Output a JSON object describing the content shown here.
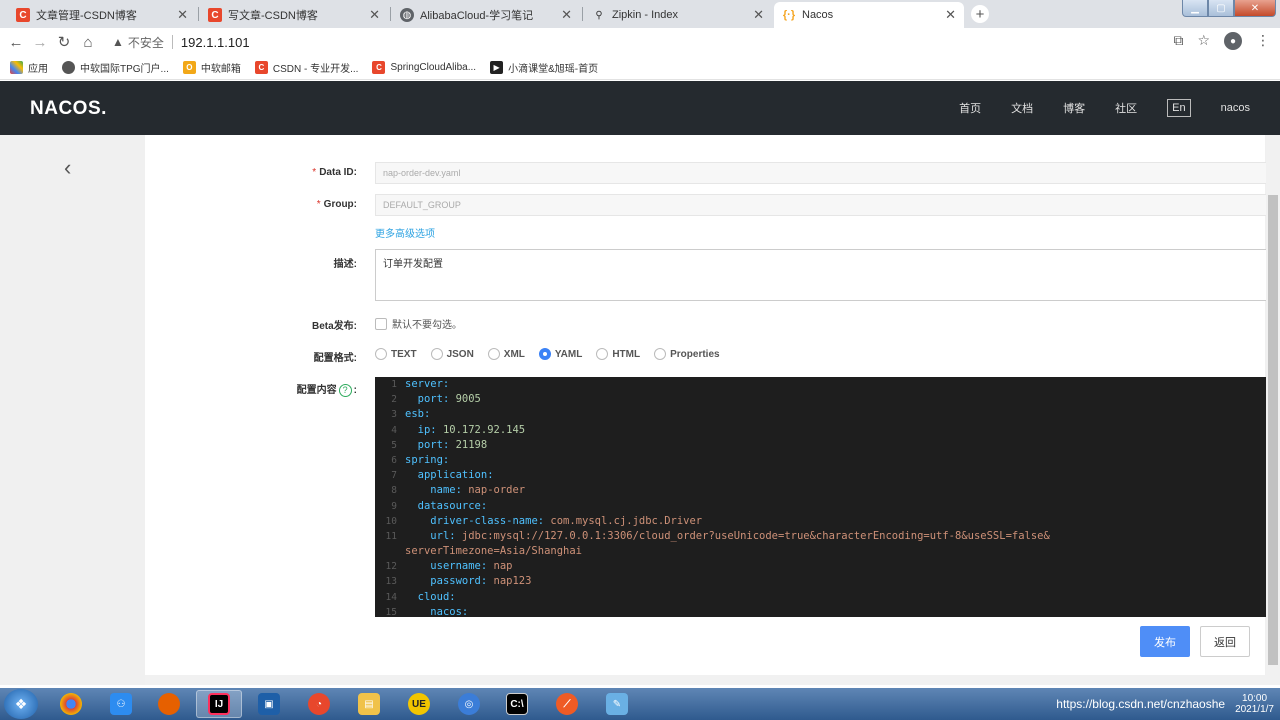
{
  "browser": {
    "tabs": [
      {
        "title": "文章管理-CSDN博客",
        "icon": "csdn-icon"
      },
      {
        "title": "写文章-CSDN博客",
        "icon": "csdn-icon"
      },
      {
        "title": "AlibabaCloud-学习笔记",
        "icon": "globe-icon"
      },
      {
        "title": "Zipkin - Index",
        "icon": "zipkin-icon"
      },
      {
        "title": "Nacos",
        "icon": "nacos-icon"
      }
    ],
    "security": "不安全",
    "url": "192.1.1.101",
    "bookmarks": [
      "应用",
      "中软国际TPG门户...",
      "中软邮箱",
      "CSDN - 专业开发...",
      "SpringCloudAliba...",
      "小滴课堂&旭瑶-首页"
    ]
  },
  "header": {
    "logo": "NACOS.",
    "menu": [
      "首页",
      "文档",
      "博客",
      "社区"
    ],
    "lang": "En",
    "user": "nacos"
  },
  "form": {
    "dataid_label": "Data ID:",
    "dataid_value": "nap-order-dev.yaml",
    "group_label": "Group:",
    "group_value": "DEFAULT_GROUP",
    "advanced": "更多高级选项",
    "desc_label": "描述:",
    "desc_value": "订单开发配置",
    "beta_label": "Beta发布:",
    "beta_hint": "默认不要勾选。",
    "format_label": "配置格式:",
    "formats": [
      "TEXT",
      "JSON",
      "XML",
      "YAML",
      "HTML",
      "Properties"
    ],
    "selected_format": "YAML",
    "content_label": "配置内容",
    "publish": "发布",
    "back": "返回"
  },
  "editor": {
    "lines": [
      {
        "n": "1",
        "indent": 0,
        "key": "server:",
        "val": ""
      },
      {
        "n": "2",
        "indent": 1,
        "key": "port:",
        "val": "9005",
        "num": true
      },
      {
        "n": "3",
        "indent": 0,
        "key": "esb:",
        "val": ""
      },
      {
        "n": "4",
        "indent": 1,
        "key": "ip:",
        "val": "10.172.92.145",
        "num": true
      },
      {
        "n": "5",
        "indent": 1,
        "key": "port:",
        "val": "21198",
        "num": true
      },
      {
        "n": "6",
        "indent": 0,
        "key": "spring:",
        "val": ""
      },
      {
        "n": "7",
        "indent": 1,
        "key": "application:",
        "val": ""
      },
      {
        "n": "8",
        "indent": 2,
        "key": "name:",
        "val": "nap-order"
      },
      {
        "n": "9",
        "indent": 1,
        "key": "datasource:",
        "val": ""
      },
      {
        "n": "10",
        "indent": 2,
        "key": "driver-class-name:",
        "val": "com.mysql.cj.jdbc.Driver"
      },
      {
        "n": "11",
        "indent": 2,
        "key": "url:",
        "val": "jdbc:mysql://127.0.0.1:3306/cloud_order?useUnicode=true&characterEncoding=utf-8&useSSL=false&"
      },
      {
        "n": "",
        "indent": 0,
        "key": "",
        "val": "serverTimezone=Asia/Shanghai"
      },
      {
        "n": "12",
        "indent": 2,
        "key": "username:",
        "val": "nap"
      },
      {
        "n": "13",
        "indent": 2,
        "key": "password:",
        "val": "nap123"
      },
      {
        "n": "14",
        "indent": 1,
        "key": "cloud:",
        "val": ""
      },
      {
        "n": "15",
        "indent": 2,
        "key": "nacos:",
        "val": ""
      }
    ]
  },
  "taskbar": {
    "tray_text": "https://blog.csdn.net/cnzhaoshe",
    "time": "10:00",
    "date": "2021/1/7"
  }
}
